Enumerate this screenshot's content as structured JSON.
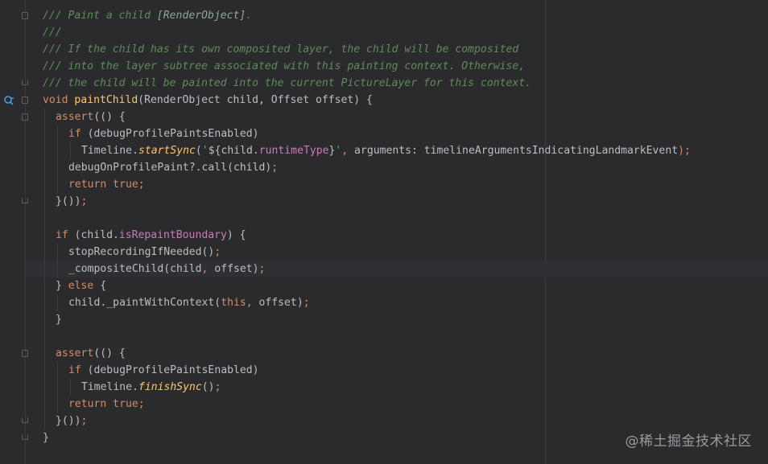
{
  "editor": {
    "gutter_icon": "implements-override-icon",
    "lines": [
      {
        "indent": 0,
        "tokens": [
          [
            "c-doc",
            "/// Paint a child "
          ],
          [
            "c-docref",
            "[RenderObject]"
          ],
          [
            "c-doc",
            "."
          ]
        ]
      },
      {
        "indent": 0,
        "tokens": [
          [
            "c-doc",
            "///"
          ]
        ]
      },
      {
        "indent": 0,
        "tokens": [
          [
            "c-doc",
            "/// If the child has its own composited layer, the child will be composited"
          ]
        ]
      },
      {
        "indent": 0,
        "tokens": [
          [
            "c-doc",
            "/// into the layer subtree associated with this painting context. Otherwise,"
          ]
        ]
      },
      {
        "indent": 0,
        "tokens": [
          [
            "c-doc",
            "/// the child will be painted into the current PictureLayer for this context."
          ]
        ]
      },
      {
        "indent": 0,
        "tokens": [
          [
            "kw",
            "void "
          ],
          [
            "decl",
            "paintChild"
          ],
          [
            "punct",
            "(RenderObject child, Offset offset) {"
          ]
        ]
      },
      {
        "indent": 1,
        "tokens": [
          [
            "kw",
            "assert"
          ],
          [
            "punct",
            "(() {"
          ]
        ]
      },
      {
        "indent": 2,
        "tokens": [
          [
            "kw",
            "if "
          ],
          [
            "punct",
            "(debugProfilePaintsEnabled)"
          ]
        ]
      },
      {
        "indent": 3,
        "tokens": [
          [
            "plain",
            "Timeline."
          ],
          [
            "static",
            "startSync"
          ],
          [
            "punct",
            "("
          ],
          [
            "str",
            "'"
          ],
          [
            "punct",
            "${child."
          ],
          [
            "prop",
            "runtimeType"
          ],
          [
            "punct",
            "}"
          ],
          [
            "str",
            "'"
          ],
          [
            "kw",
            ", "
          ],
          [
            "plain",
            "arguments: timelineArgumentsIndicatingLandmarkEvent"
          ],
          [
            "kw",
            ");"
          ]
        ]
      },
      {
        "indent": 2,
        "tokens": [
          [
            "plain",
            "debugOnProfilePaint?.call(child)"
          ],
          [
            "kw",
            ";"
          ]
        ]
      },
      {
        "indent": 2,
        "tokens": [
          [
            "kw",
            "return true;"
          ]
        ]
      },
      {
        "indent": 1,
        "tokens": [
          [
            "punct",
            "}())"
          ],
          [
            "kw",
            ";"
          ]
        ]
      },
      {
        "indent": 0,
        "tokens": []
      },
      {
        "indent": 1,
        "tokens": [
          [
            "kw",
            "if "
          ],
          [
            "punct",
            "(child."
          ],
          [
            "prop",
            "isRepaintBoundary"
          ],
          [
            "punct",
            ") {"
          ]
        ]
      },
      {
        "indent": 2,
        "tokens": [
          [
            "plain",
            "stopRecordingIfNeeded()"
          ],
          [
            "kw",
            ";"
          ]
        ]
      },
      {
        "indent": 2,
        "tokens": [
          [
            "plain",
            "_compositeChild(child"
          ],
          [
            "kw",
            ", "
          ],
          [
            "plain",
            "offset)"
          ],
          [
            "kw",
            ";"
          ]
        ]
      },
      {
        "indent": 1,
        "tokens": [
          [
            "punct",
            "} "
          ],
          [
            "kw",
            "else "
          ],
          [
            "punct",
            "{"
          ]
        ]
      },
      {
        "indent": 2,
        "tokens": [
          [
            "plain",
            "child._paintWithContext("
          ],
          [
            "kw",
            "this, "
          ],
          [
            "plain",
            "offset)"
          ],
          [
            "kw",
            ";"
          ]
        ]
      },
      {
        "indent": 1,
        "tokens": [
          [
            "punct",
            "}"
          ]
        ]
      },
      {
        "indent": 0,
        "tokens": []
      },
      {
        "indent": 1,
        "tokens": [
          [
            "kw",
            "assert"
          ],
          [
            "punct",
            "(() {"
          ]
        ]
      },
      {
        "indent": 2,
        "tokens": [
          [
            "kw",
            "if "
          ],
          [
            "punct",
            "(debugProfilePaintsEnabled)"
          ]
        ]
      },
      {
        "indent": 3,
        "tokens": [
          [
            "plain",
            "Timeline."
          ],
          [
            "static",
            "finishSync"
          ],
          [
            "punct",
            "()"
          ],
          [
            "kw",
            ";"
          ]
        ]
      },
      {
        "indent": 2,
        "tokens": [
          [
            "kw",
            "return true;"
          ]
        ]
      },
      {
        "indent": 1,
        "tokens": [
          [
            "punct",
            "}())"
          ],
          [
            "kw",
            ";"
          ]
        ]
      },
      {
        "indent": 0,
        "tokens": [
          [
            "punct",
            "}"
          ]
        ]
      }
    ]
  },
  "watermark": {
    "text": "@稀土掘金技术社区"
  }
}
